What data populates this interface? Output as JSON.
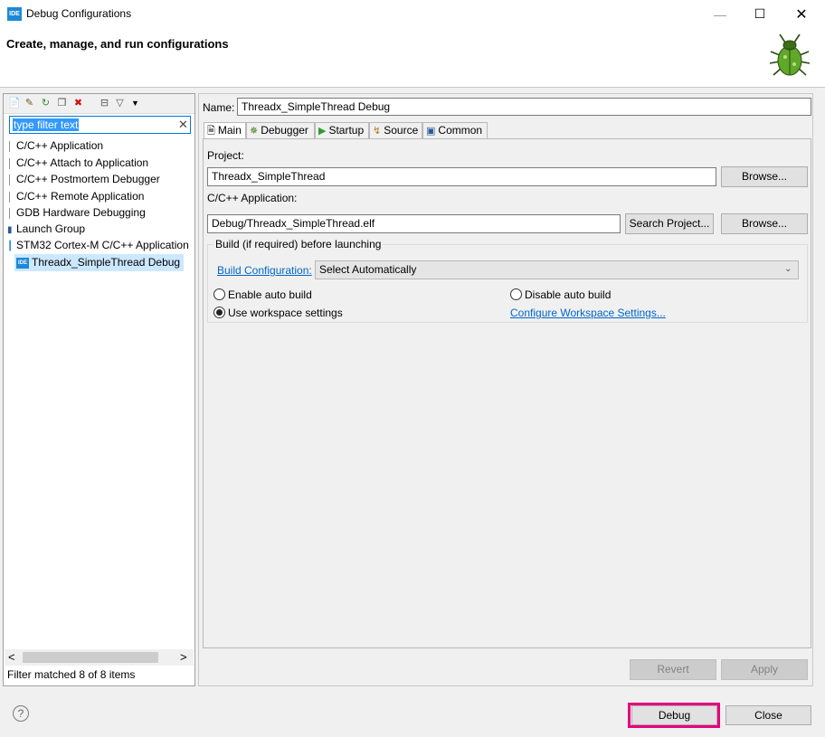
{
  "window": {
    "app_icon_text": "IDE",
    "title": "Debug Configurations",
    "min_glyph": "—",
    "max_glyph": "☐",
    "close_glyph": "✕"
  },
  "header": {
    "title": "Create, manage, and run configurations"
  },
  "left": {
    "toolbar": [
      "new-configuration-icon",
      "new-prototype-icon",
      "export-icon",
      "duplicate-icon",
      "delete-icon",
      "collapse-all-icon",
      "filter-icon",
      "view-menu-icon"
    ],
    "filter": {
      "value": "type filter text",
      "clear_glyph": "✕"
    },
    "tree": [
      "C/C++ Application",
      "C/C++ Attach to Application",
      "C/C++ Postmortem Debugger",
      "C/C++ Remote Application",
      "GDB Hardware Debugging",
      "Launch Group",
      "STM32 Cortex-M C/C++ Application"
    ],
    "selected": {
      "icon_text": "IDE",
      "label": "Threadx_SimpleThread Debug"
    },
    "scroll_left": "<",
    "scroll_right": ">",
    "status": "Filter matched 8 of 8 items"
  },
  "right": {
    "name_label": "Name:",
    "name_value": "Threadx_SimpleThread Debug",
    "tabs": [
      "Main",
      "Debugger",
      "Startup",
      "Source",
      "Common"
    ],
    "project_label": "Project:",
    "project_value": "Threadx_SimpleThread",
    "browse_label": "Browse...",
    "app_label": "C/C++ Application:",
    "app_value": "Debug/Threadx_SimpleThread.elf",
    "search_project_label": "Search Project...",
    "build_group_label": "Build (if required) before launching",
    "build_config_link": "Build Configuration:",
    "build_config_value": "Select Automatically",
    "enable_auto_build": "Enable auto build",
    "disable_auto_build": "Disable auto build",
    "use_workspace": "Use workspace settings",
    "configure_workspace_link": "Configure Workspace Settings...",
    "revert_label": "Revert",
    "apply_label": "Apply"
  },
  "footer": {
    "help_glyph": "?",
    "debug_label": "Debug",
    "close_label": "Close"
  },
  "colors": {
    "highlight": "#e6007e",
    "selection": "#cce8ff",
    "link": "#0066cc"
  }
}
